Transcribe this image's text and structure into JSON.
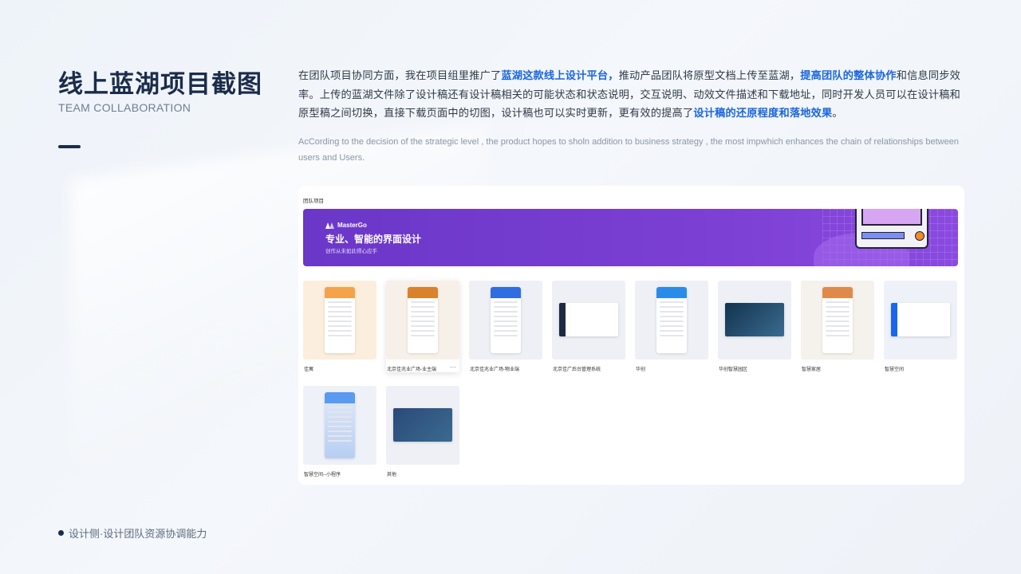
{
  "slide": {
    "title": "线上蓝湖项目截图",
    "subtitle": "TEAM COLLABORATION",
    "footer": "设计侧·设计团队资源协调能力"
  },
  "intro": {
    "seg1": "在团队项目协同方面，我在项目组里推广了",
    "hl1": "蓝湖这款线上设计平台，",
    "seg2": "推动产品团队将原型文档上传至蓝湖，",
    "hl2": "提高团队的整体协作",
    "seg3": "和信息同步效率。上传的蓝湖文件除了设计稿还有设计稿相关的可能状态和状态说明，交互说明、动效文件描述和下载地址，同时开发人员可以在设计稿和原型稿之间切换，直接下载页面中的切图，设计稿也可以实时更新，更有效的提高了",
    "hl3": "设计稿的还原程度和落地效果",
    "seg4": "。",
    "english": "AcCording to the decision of the strategic level , the product hopes to sholn addition to business strategy , the most impwhich enhances the chain of relationships between users and Users."
  },
  "panel": {
    "label": "团队项目",
    "banner": {
      "brand": "MasterGo",
      "title": "专业、智能的界面设计",
      "slogan": "创作从未如此得心应手"
    },
    "projects": [
      {
        "name": "佳寓",
        "bg": "#fbeedd",
        "accent": "#f5a34a"
      },
      {
        "name": "北京佳兆业广场-业主端",
        "bg": "#f7f0e9",
        "accent": "#d9822b",
        "active": true
      },
      {
        "name": "北京佳兆业广场-物业端",
        "bg": "#eef0f5",
        "accent": "#2f6de0"
      },
      {
        "name": "北京佳广后台管理系统",
        "bg": "#eef0f5",
        "accent": "#1c2a44"
      },
      {
        "name": "华创",
        "bg": "#eef0f5",
        "accent": "#2a8ce8"
      },
      {
        "name": "华创智慧园区",
        "bg": "#eef0f5",
        "accent": "#12344f"
      },
      {
        "name": "智慧家居",
        "bg": "#f5f1ec",
        "accent": "#e08a4a"
      },
      {
        "name": "智慧空间",
        "bg": "#eef2f8",
        "accent": "#1b66f0"
      },
      {
        "name": "智慧空间--小程序",
        "bg": "#eef2f8",
        "accent": "#5a9af0"
      },
      {
        "name": "其他",
        "bg": "#eef0f5",
        "accent": "#2b4a7a"
      }
    ]
  }
}
